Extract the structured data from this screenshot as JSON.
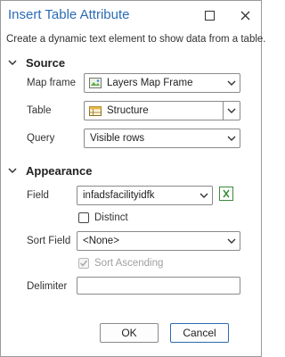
{
  "dialog": {
    "title": "Insert Table Attribute",
    "description": "Create a dynamic text element to show data from a table."
  },
  "source": {
    "header": "Source",
    "map_frame": {
      "label": "Map frame",
      "value": "Layers Map Frame"
    },
    "table": {
      "label": "Table",
      "value": "Structure"
    },
    "query": {
      "label": "Query",
      "value": "Visible rows"
    }
  },
  "appearance": {
    "header": "Appearance",
    "field": {
      "label": "Field",
      "value": "infadsfacilityidfk"
    },
    "distinct": {
      "label": "Distinct",
      "checked": false
    },
    "sort_field": {
      "label": "Sort Field",
      "value": "<None>"
    },
    "sort_ascending": {
      "label": "Sort Ascending",
      "checked": true,
      "enabled": false
    },
    "delimiter": {
      "label": "Delimiter",
      "value": ""
    }
  },
  "buttons": {
    "ok": "OK",
    "cancel": "Cancel"
  },
  "colors": {
    "title": "#2b6cb5",
    "accent_border": "#2b6cb5",
    "expression_icon": "#3a8a3a"
  },
  "icons": [
    "maximize-icon",
    "close-icon",
    "chevron-down-icon",
    "map-frame-icon",
    "table-icon",
    "expression-icon",
    "checkmark-icon"
  ]
}
